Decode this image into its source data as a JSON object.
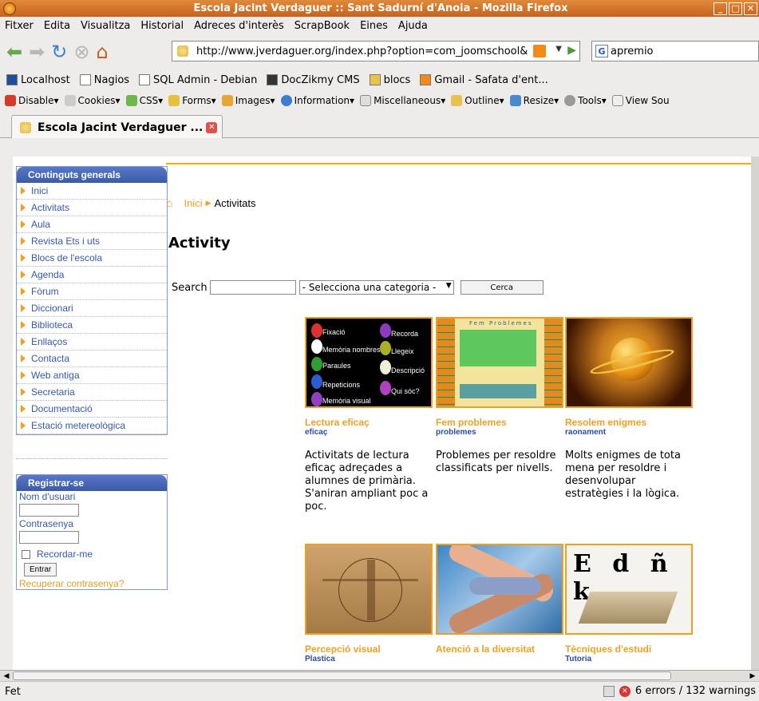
{
  "window": {
    "title": "Escola Jacint Verdaguer :: Sant Sadurní d'Anoia - Mozilla Firefox"
  },
  "menubar": [
    "Fitxer",
    "Edita",
    "Visualitza",
    "Historial",
    "Adreces d'interès",
    "ScrapBook",
    "Eines",
    "Ajuda"
  ],
  "navbar": {
    "url": "http://www.jverdaguer.org/index.php?option=com_joomschool&",
    "search_value": "apremio"
  },
  "bookmarks": [
    "Localhost",
    "Nagios",
    "SQL Admin - Debian",
    "DocZikmy CMS",
    "blocs",
    "Gmail - Safata d'ent..."
  ],
  "devbar": [
    "Disable▾",
    "Cookies▾",
    "CSS▾",
    "Forms▾",
    "Images▾",
    "Information▾",
    "Miscellaneous▾",
    "Outline▾",
    "Resize▾",
    "Tools▾",
    "View Sou"
  ],
  "tab": {
    "label": "Escola Jacint Verdaguer ..."
  },
  "sidebar": {
    "title": "Continguts generals",
    "items": [
      "Inici",
      "Activitats",
      "Aula",
      "Revista Ets i uts",
      "Blocs de l'escola",
      "Agenda",
      "Fòrum",
      "Diccionari",
      "Biblioteca",
      "Enllaços",
      "Contacta",
      "Web antiga",
      "Secretaria",
      "Documentació",
      "Estació metereològica"
    ]
  },
  "login": {
    "title": "Registrar-se",
    "user_label": "Nom d'usuari",
    "pass_label": "Contrasenya",
    "remember_label": "Recordar-me",
    "submit_label": "Entrar",
    "recover_label": "Recuperar contrasenya?"
  },
  "breadcrumb": {
    "home": "Inici",
    "current": "Activitats"
  },
  "page": {
    "title": "Activity"
  },
  "search": {
    "label": "Search",
    "category_placeholder": "- Selecciona una categoria -",
    "button": "Cerca"
  },
  "activities": [
    {
      "title": "Lectura eficaç",
      "sub": "eficaç",
      "desc": "Activitats de lectura eficaç adreçades a alumnes de primària. S'aniran ampliant poc a poc."
    },
    {
      "title": "Fem problemes",
      "sub": "problemes",
      "desc": "Problemes per resoldre classificats per nivells."
    },
    {
      "title": "Resolem enigmes",
      "sub": "raonament",
      "desc": "Molts enigmes de tota mena per resoldre i desenvolupar estratègies i la lògica."
    },
    {
      "title": "Percepció visual",
      "sub": "Plastica",
      "desc": ""
    },
    {
      "title": "Atenció a la diversitat",
      "sub": "",
      "desc": ""
    },
    {
      "title": "Tècniques d'estudi",
      "sub": "Tutoria",
      "desc": ""
    }
  ],
  "thumb1_labels": [
    "Fixació",
    "Recorda",
    "Memòria nombres",
    "Llegeix",
    "Paraules",
    "Descripció",
    "Repeticions",
    "Qui sóc?",
    "Memòria visual"
  ],
  "thumb2_title": "Fem Problemes",
  "thumb6_letters": "E d ñ k",
  "status": {
    "left": "Fet",
    "right": "6 errors / 132 warnings"
  }
}
